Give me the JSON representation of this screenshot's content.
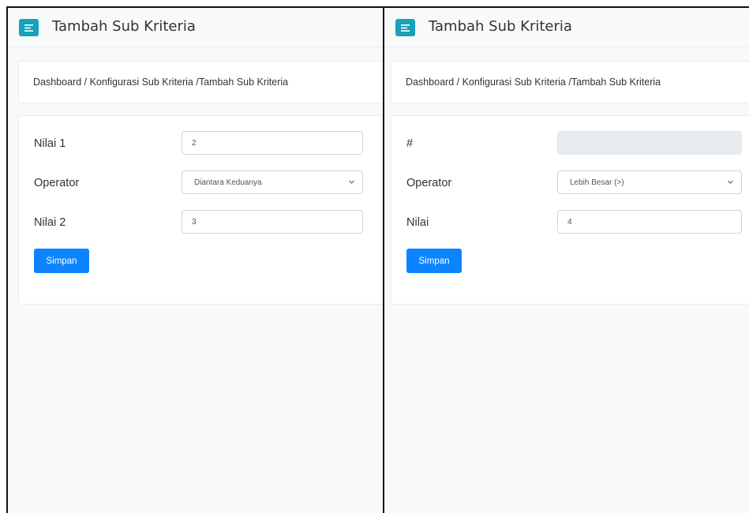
{
  "left": {
    "title": "Tambah Sub Kriteria",
    "breadcrumb": "Dashboard / Konfigurasi Sub Kriteria /Tambah Sub Kriteria",
    "fields": [
      {
        "label": "Nilai 1",
        "value": "2"
      },
      {
        "label": "Operator",
        "value": "Diantara Keduanya"
      },
      {
        "label": "Nilai 2",
        "value": "3"
      }
    ],
    "save_label": "Simpan"
  },
  "right": {
    "title": "Tambah Sub Kriteria",
    "breadcrumb": "Dashboard / Konfigurasi Sub Kriteria /Tambah Sub Kriteria",
    "fields": [
      {
        "label": "#",
        "value": ""
      },
      {
        "label": "Operator",
        "value": "Lebih Besar (>)"
      },
      {
        "label": "Nilai",
        "value": "4"
      }
    ],
    "save_label": "Simpan"
  },
  "colors": {
    "menu_button": "#17a2b8",
    "primary_button": "#0d84ff",
    "page_background": "#f8f9fa"
  },
  "icons": {
    "menu": "hamburger-menu-icon",
    "select": "chevron-down-icon"
  }
}
